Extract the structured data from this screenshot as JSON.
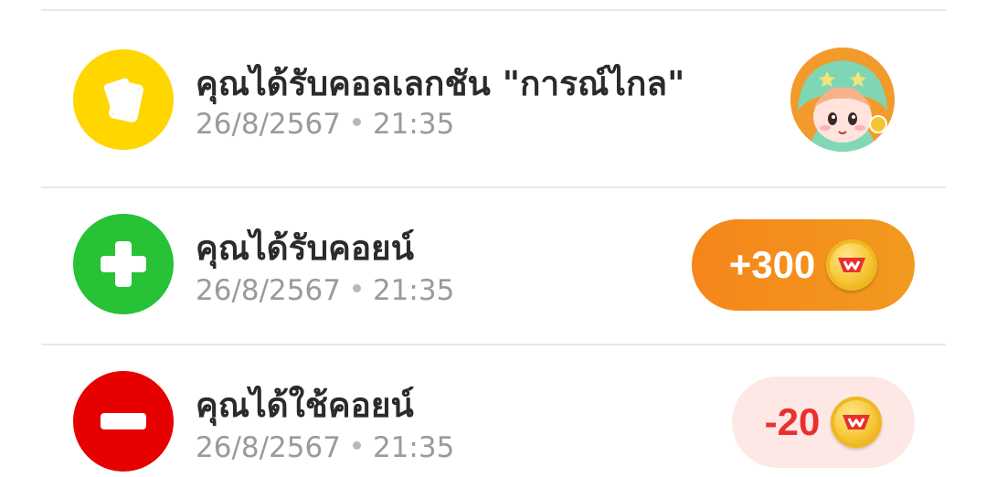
{
  "notifications": [
    {
      "type": "collection",
      "title": "คุณได้รับคอลเลกชัน \"การณ์ไกล\"",
      "date": "26/8/2567",
      "time": "21:35",
      "icon": "cards-icon",
      "icon_color": "#ffd600"
    },
    {
      "type": "coin-received",
      "title": "คุณได้รับคอยน์",
      "date": "26/8/2567",
      "time": "21:35",
      "icon": "plus-icon",
      "icon_color": "#27c236",
      "amount": "+300",
      "amount_color": "#ffffff",
      "pill_color": "#f5861a"
    },
    {
      "type": "coin-used",
      "title": "คุณได้ใช้คอยน์",
      "date": "26/8/2567",
      "time": "21:35",
      "icon": "minus-icon",
      "icon_color": "#e60000",
      "amount": "-20",
      "amount_color": "#e8312e",
      "pill_color": "#fde8e6"
    }
  ]
}
